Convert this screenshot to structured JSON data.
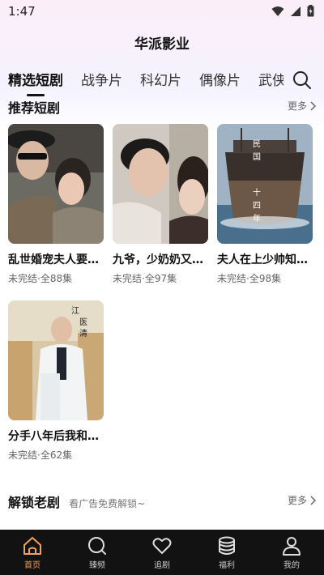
{
  "status_bar": {
    "time": "1:47"
  },
  "app_title": "华派影业",
  "tabs": [
    "精选短剧",
    "战争片",
    "科幻片",
    "偶像片",
    "武侠"
  ],
  "sections": {
    "recommended": {
      "title": "推荐短剧",
      "more": "更多"
    },
    "unlock": {
      "title": "解锁老剧",
      "subtitle": "看广告免费解锁~",
      "more": "更多"
    }
  },
  "cards": [
    {
      "title": "乱世婚宠夫人要…",
      "meta": "未完结·全88集"
    },
    {
      "title": "九爷，少奶奶又…",
      "meta": "未完结·全97集"
    },
    {
      "title": "夫人在上少帅知…",
      "meta": "未完结·全98集"
    },
    {
      "title": "分手八年后我和…",
      "meta": "未完结·全62集"
    }
  ],
  "cover_texts": {
    "card3": [
      "民",
      "国",
      "十",
      "四",
      "年"
    ],
    "card4": [
      "江",
      "医",
      "清"
    ]
  },
  "bottom_nav": [
    {
      "label": "首页",
      "icon": "home-icon",
      "active": true
    },
    {
      "label": "臻频",
      "icon": "search-icon",
      "active": false
    },
    {
      "label": "追剧",
      "icon": "heart-icon",
      "active": false
    },
    {
      "label": "福利",
      "icon": "coins-icon",
      "active": false
    },
    {
      "label": "我的",
      "icon": "user-icon",
      "active": false
    }
  ],
  "colors": {
    "accent": "#f0a15a",
    "nav_bg": "#121212"
  }
}
